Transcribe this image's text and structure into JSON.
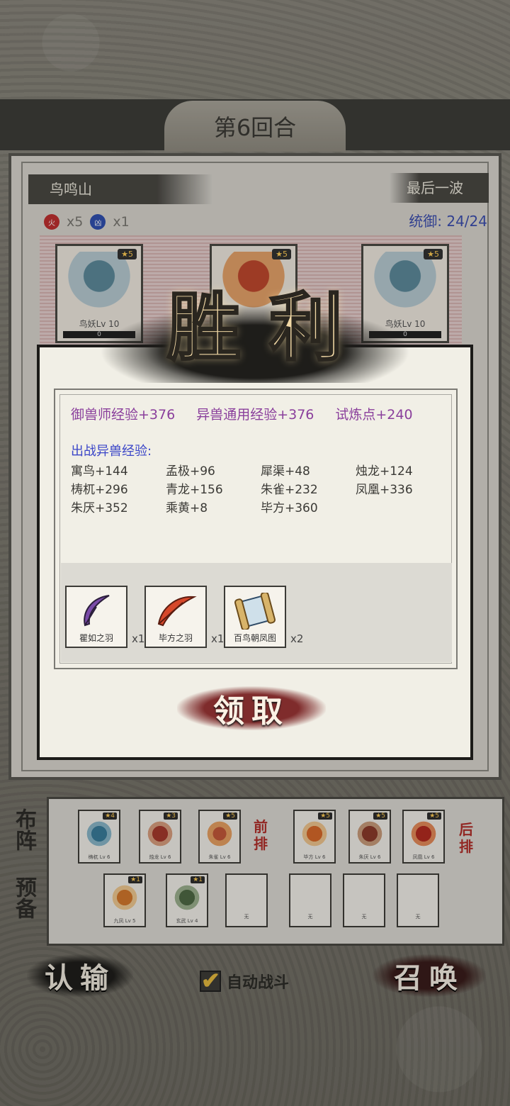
{
  "header": {
    "round": "第6回合"
  },
  "battle": {
    "region": "鸟鸣山",
    "wave": "最后一波",
    "command": "统御: 24/24",
    "elements": [
      {
        "symbol": "火",
        "count": "x5",
        "color": "#c03030"
      },
      {
        "symbol": "凶",
        "count": "x1",
        "color": "#3050b0"
      }
    ],
    "enemies": [
      {
        "stars": "5",
        "level": "鸟妖Lv 10",
        "hp": "0"
      },
      {
        "stars": "5",
        "level": "",
        "hp": ""
      },
      {
        "stars": "5",
        "level": "鸟妖Lv 10",
        "hp": "0"
      }
    ]
  },
  "victory": {
    "title_1": "胜",
    "title_2": "利",
    "rewards": [
      "御兽师经验+376",
      "异兽通用经验+376",
      "试炼点+240"
    ],
    "section_title": "出战异兽经验:",
    "exp_entries": [
      "寓鸟+144",
      "孟极+96",
      "犀渠+48",
      "烛龙+124",
      "梼杌+296",
      "青龙+156",
      "朱雀+232",
      "凤凰+336",
      "朱厌+352",
      "乘黄+8",
      "毕方+360"
    ],
    "items": [
      {
        "name": "瞿如之羽",
        "qty": "x1",
        "icon": "purple-feather-icon"
      },
      {
        "name": "毕方之羽",
        "qty": "x1",
        "icon": "red-feather-icon"
      },
      {
        "name": "百鸟朝凤图",
        "qty": "x2",
        "icon": "scroll-icon"
      }
    ],
    "claim": "领取"
  },
  "formation": {
    "tab_formation": "布阵",
    "tab_reserve": "预备",
    "front_row_label": "前排",
    "back_row_label": "后排",
    "front": [
      {
        "stars": "4",
        "name": "梼杌 Lv 6"
      },
      {
        "stars": "3",
        "name": "烛龙 Lv 6"
      },
      {
        "stars": "5",
        "name": "朱雀 Lv 6"
      }
    ],
    "back": [
      {
        "stars": "5",
        "name": "毕方 Lv 6"
      },
      {
        "stars": "5",
        "name": "朱厌 Lv 6"
      },
      {
        "stars": "5",
        "name": "凤凰 Lv 6"
      }
    ],
    "reserve": [
      {
        "stars": "1",
        "name": "九凤 Lv 5"
      },
      {
        "stars": "1",
        "name": "玄武 Lv 4"
      },
      {
        "stars": "",
        "name": "无"
      },
      {
        "stars": "",
        "name": "无"
      },
      {
        "stars": "",
        "name": "无"
      },
      {
        "stars": "",
        "name": "无"
      }
    ]
  },
  "controls": {
    "surrender": "认输",
    "auto_battle": "自动战斗",
    "auto_checked": "✔",
    "summon": "召唤"
  }
}
